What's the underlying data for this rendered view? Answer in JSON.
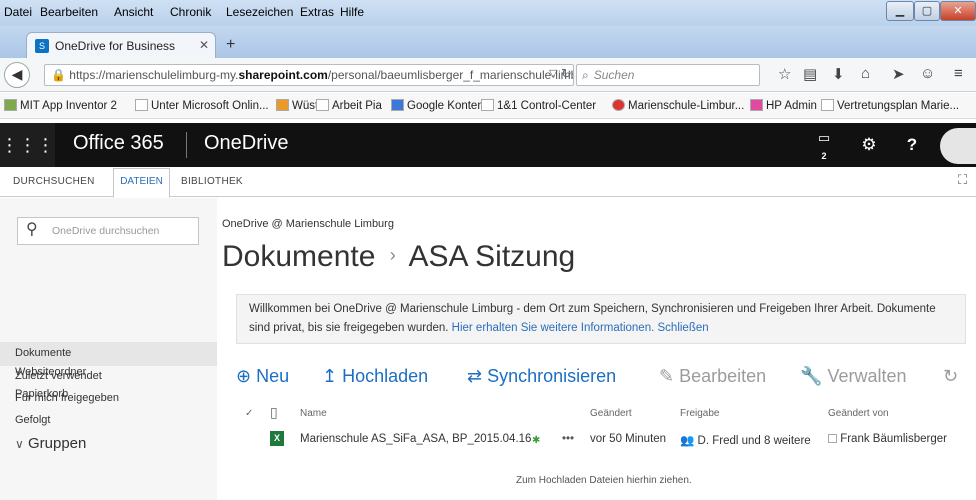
{
  "browser": {
    "menu": [
      "Datei",
      "Bearbeiten",
      "Ansicht",
      "Chronik",
      "Lesezeichen",
      "Extras",
      "Hilfe"
    ],
    "tab_title": "OneDrive for Business",
    "url_prefix": "https://marienschulelimburg-my.",
    "url_domain": "sharepoint.com",
    "url_path": "/personal/baeumlisberger_f_marienschule-limbu",
    "search_placeholder": "Suchen",
    "bookmarks": [
      "MIT App Inventor 2",
      "Unter Microsoft Onlin...",
      "Wüst",
      "Arbeit Pia",
      "Google Konten",
      "1&1 Control-Center",
      "Marienschule-Limbur...",
      "HP Admin",
      "Vertretungsplan Marie..."
    ]
  },
  "o365": {
    "suite_title": "Office 365",
    "app_name": "OneDrive",
    "notification_count": "2",
    "help_label": "?"
  },
  "ribbon": {
    "tabs": [
      "DURCHSUCHEN",
      "DATEIEN",
      "BIBLIOTHEK"
    ]
  },
  "sidebar": {
    "search_placeholder": "OneDrive durchsuchen",
    "items": [
      "Dokumente",
      "Zuletzt verwendet",
      "Für mich freigegeben",
      "Gefolgt",
      "Websiteordner",
      "Papierkorb"
    ],
    "groups_label": "Gruppen"
  },
  "main": {
    "site_name": "OneDrive @ Marienschule Limburg",
    "title_root": "Dokumente",
    "title_sep": "›",
    "title_folder": "ASA Sitzung",
    "welcome_text": "Willkommen bei OneDrive @ Marienschule Limburg - dem Ort zum Speichern, Synchronisieren und Freigeben Ihrer Arbeit. Dokumente sind privat, bis sie freigegeben wurden.",
    "welcome_link": "Hier erhalten Sie weitere Informationen.",
    "close_link": "Schließen",
    "commands": {
      "new": "Neu",
      "upload": "Hochladen",
      "sync": "Synchronisieren",
      "edit": "Bearbeiten",
      "manage": "Verwalten"
    },
    "columns": {
      "name": "Name",
      "modified": "Geändert",
      "sharing": "Freigabe",
      "modified_by": "Geändert von"
    },
    "files": [
      {
        "name": "Marienschule AS_SiFa_ASA, BP_2015.04.16",
        "new_marker": "✱",
        "more": "•••",
        "modified": "vor 50 Minuten",
        "sharing": "D. Fredl und 8 weitere",
        "modified_by": "Frank Bäumlisberger"
      }
    ],
    "drop_hint": "Zum Hochladen Dateien hierhin ziehen."
  },
  "colors": {
    "accent": "#1e6ec2",
    "o365_bar": "#111111",
    "excel_green": "#1d7a3a"
  }
}
